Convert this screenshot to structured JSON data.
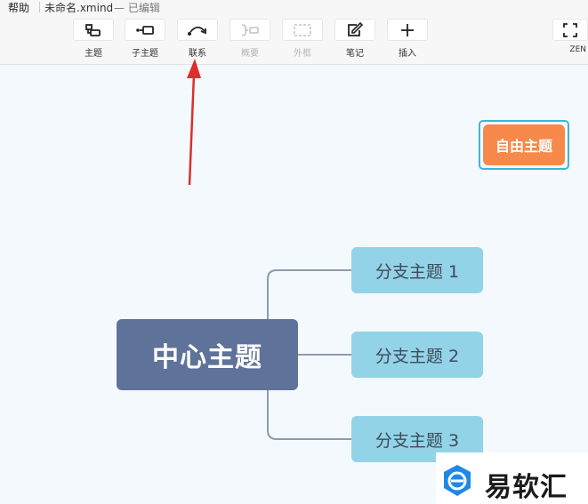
{
  "header": {
    "help_menu": "帮助",
    "filename": "未命名.xmind",
    "status": "— 已编辑"
  },
  "toolbar": {
    "items": [
      {
        "label": "主题",
        "icon": "topic-icon",
        "enabled": true
      },
      {
        "label": "子主题",
        "icon": "subtopic-icon",
        "enabled": true
      },
      {
        "label": "联系",
        "icon": "relationship-icon",
        "enabled": true
      },
      {
        "label": "概要",
        "icon": "summary-icon",
        "enabled": false
      },
      {
        "label": "外框",
        "icon": "boundary-icon",
        "enabled": false
      },
      {
        "label": "笔记",
        "icon": "note-icon",
        "enabled": true
      },
      {
        "label": "插入",
        "icon": "plus-icon",
        "enabled": true
      },
      {
        "label": "ZEN",
        "icon": "fullscreen-icon",
        "enabled": true
      }
    ]
  },
  "mindmap": {
    "central_topic": "中心主题",
    "branches": [
      "分支主题 1",
      "分支主题 2",
      "分支主题 3"
    ],
    "free_topic": "自由主题"
  },
  "watermark": {
    "text": "易软汇"
  },
  "colors": {
    "central": "#5f7299",
    "branch": "#93d3e8",
    "free_topic": "#f7894a",
    "selection": "#39b7d6",
    "arrow": "#d9302c",
    "logo_blue": "#1e88e5"
  }
}
